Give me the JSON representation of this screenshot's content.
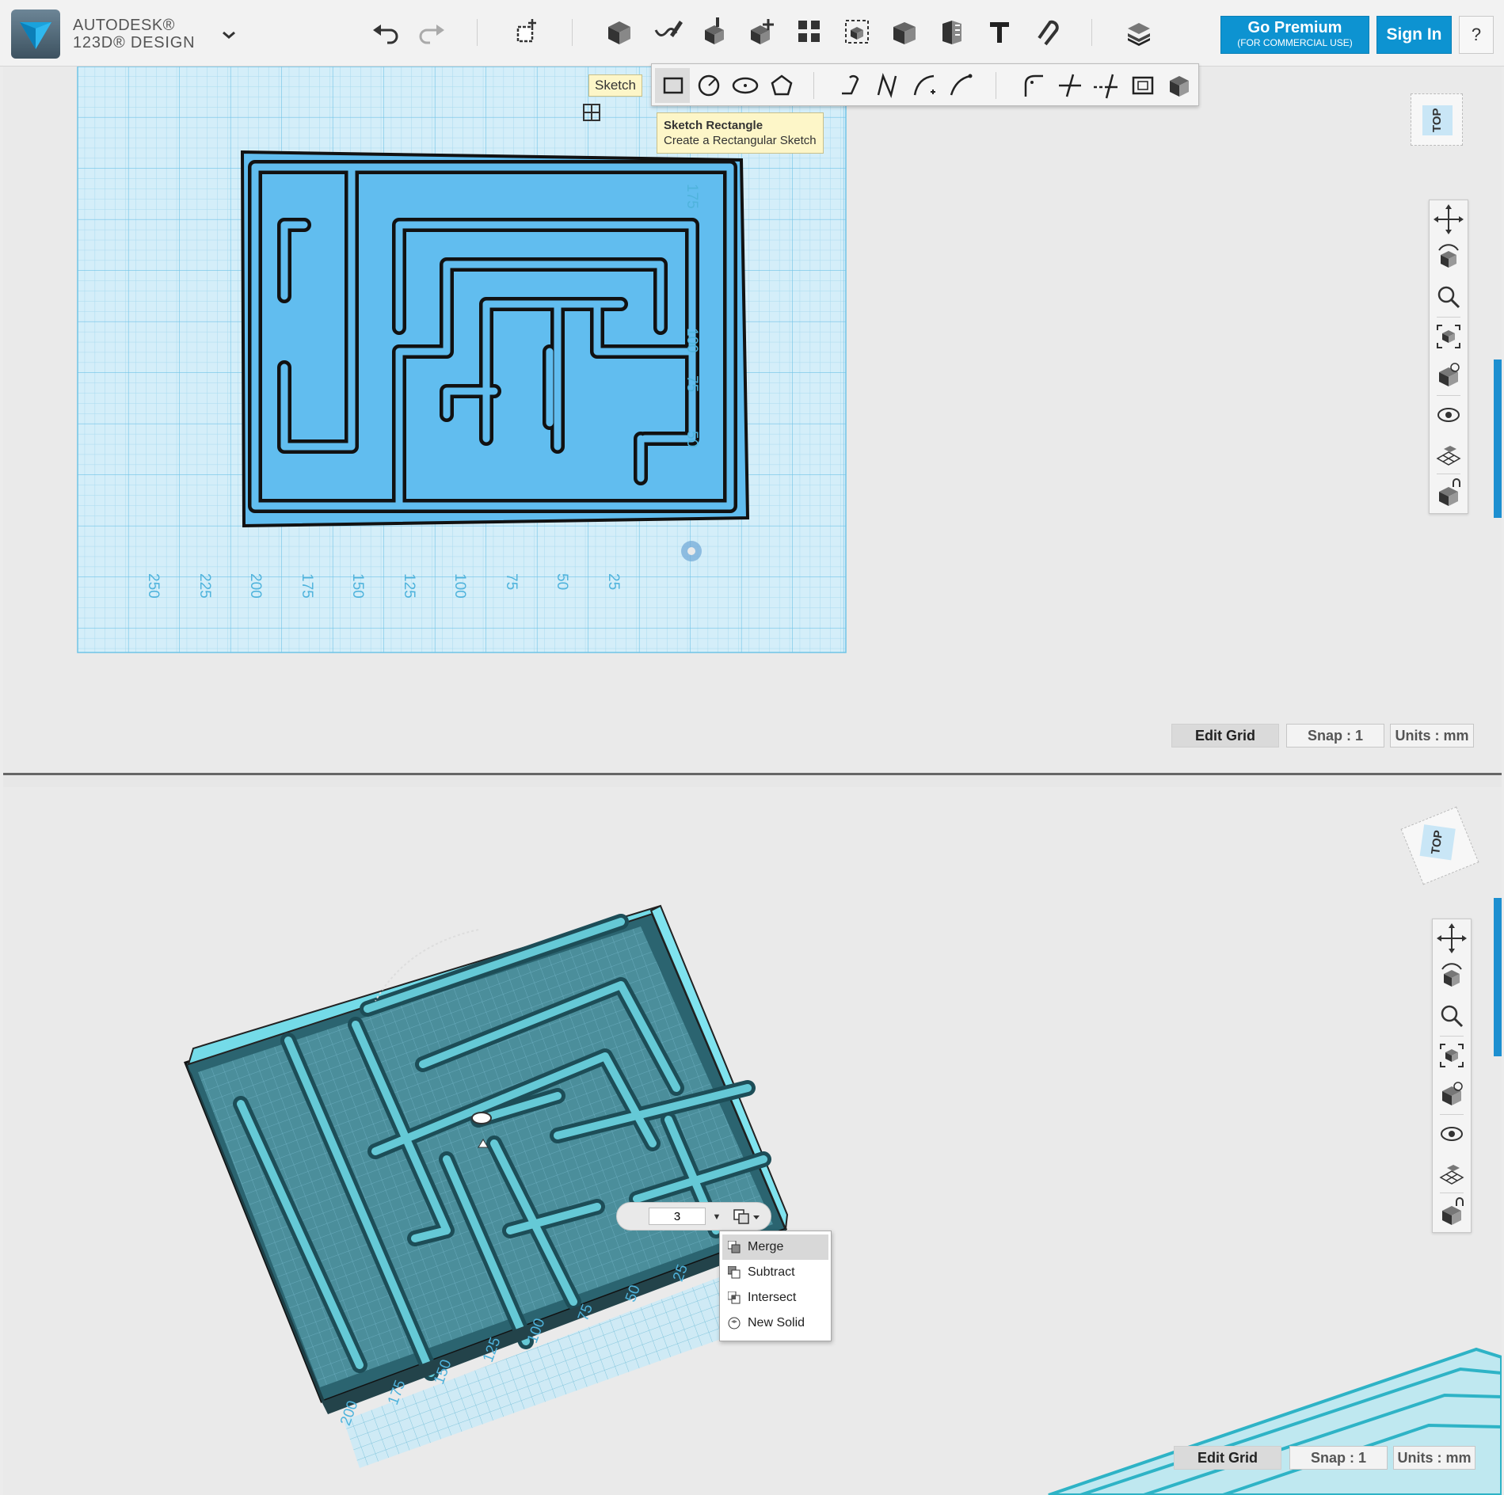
{
  "app": {
    "brand_line1": "AUTODESK®",
    "brand_line2": "123D® DESIGN"
  },
  "header": {
    "premium_line1": "Go Premium",
    "premium_line2": "(FOR COMMERCIAL USE)",
    "signin_label": "Sign In",
    "help_label": "?"
  },
  "toolbar_icons": [
    "undo-icon",
    "redo-icon",
    "transform-icon",
    "primitives-icon",
    "sketch-icon",
    "construct-icon",
    "modify-icon",
    "pattern-icon",
    "grouping-icon",
    "combine-icon",
    "measure-icon",
    "text-icon",
    "snap-icon",
    "materials-icon"
  ],
  "sketch_flyout": {
    "tooltip": "Sketch",
    "hint_title": "Sketch Rectangle",
    "hint_desc": "Create a Rectangular Sketch"
  },
  "viewport_top": {
    "view_cube_label": "TOP",
    "x_ticks": [
      "250",
      "225",
      "200",
      "175",
      "150",
      "125",
      "100",
      "75",
      "50",
      "25"
    ],
    "y_ticks": [
      "175",
      "100",
      "75",
      "50"
    ],
    "edit_grid": "Edit Grid",
    "snap": "Snap  :  1",
    "units": "Units : mm"
  },
  "viewport_bottom": {
    "view_cube_label": "TOP",
    "ticks": [
      "200",
      "175",
      "150",
      "125",
      "100",
      "75",
      "50",
      "25"
    ],
    "extrude_value": "3",
    "operations": [
      "Merge",
      "Subtract",
      "Intersect",
      "New Solid"
    ],
    "selected_operation": "Merge",
    "edit_grid": "Edit Grid",
    "snap": "Snap  :  1",
    "units": "Units : mm"
  },
  "nav_icons": [
    "pan-icon",
    "orbit-icon",
    "zoom-icon",
    "fit-icon",
    "view-cube-icon",
    "visibility-icon",
    "grid-material-icon",
    "snap-lock-icon"
  ],
  "colors": {
    "accent": "#0d93d1",
    "maze_fill": "#5bbcee",
    "grid_line": "#9fd4ec",
    "solid_face": "#4b9eae",
    "solid_top": "#6cd0da"
  }
}
